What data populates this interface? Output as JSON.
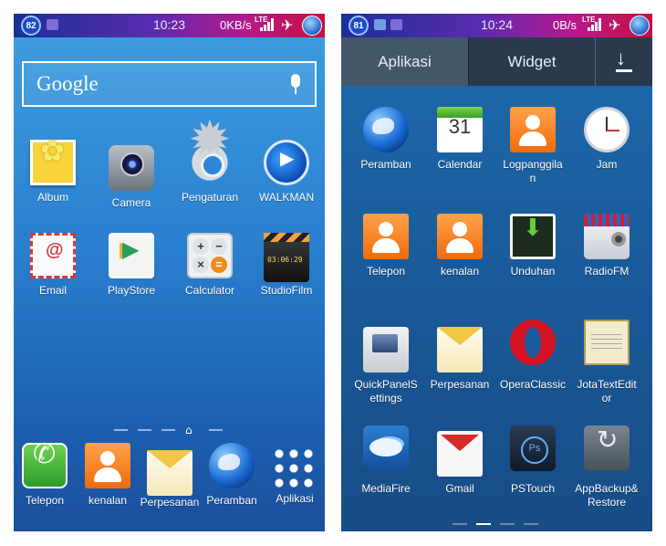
{
  "left_screen": {
    "status": {
      "battery": "82",
      "time": "10:23",
      "speed": "0KB/s",
      "network": "LTE"
    },
    "search": {
      "logo": "Google"
    },
    "apps": [
      "Album",
      "Camera",
      "Pengaturan",
      "WALKMAN",
      "Email",
      "PlayStore",
      "Calculator",
      "StudioFilm"
    ],
    "dock": [
      "Telepon",
      "kenalan",
      "Perpesanan",
      "Peramban",
      "Aplikasi"
    ]
  },
  "right_screen": {
    "status": {
      "battery": "81",
      "time": "10:24",
      "speed": "0B/s",
      "network": "LTE"
    },
    "tabs": {
      "apps": "Aplikasi",
      "widget": "Widget"
    },
    "apps": [
      "Peramban",
      "Calendar",
      "Logpanggila\nn",
      "Jam",
      "Telepon",
      "kenalan",
      "Unduhan",
      "RadioFM",
      "QuickPanelS\nettings",
      "Perpesanan",
      "OperaClassic",
      "JotaTextEdit\nor",
      "MediaFire",
      "Gmail",
      "PSTouch",
      "AppBackup&\nRestore"
    ],
    "calendar_day": "31"
  },
  "icons": {
    "status": [
      "battery-icon",
      "notification-icon",
      "signal-icon",
      "airplane-icon",
      "app-ball-icon"
    ],
    "download": "download-icon",
    "home": "home-icon",
    "mic": "mic-icon"
  },
  "colors": {
    "statusbar_start": "#1a2f9a",
    "statusbar_end": "#c8103e",
    "tab_active": "#445669",
    "tab_bar": "#2a3a4d"
  }
}
